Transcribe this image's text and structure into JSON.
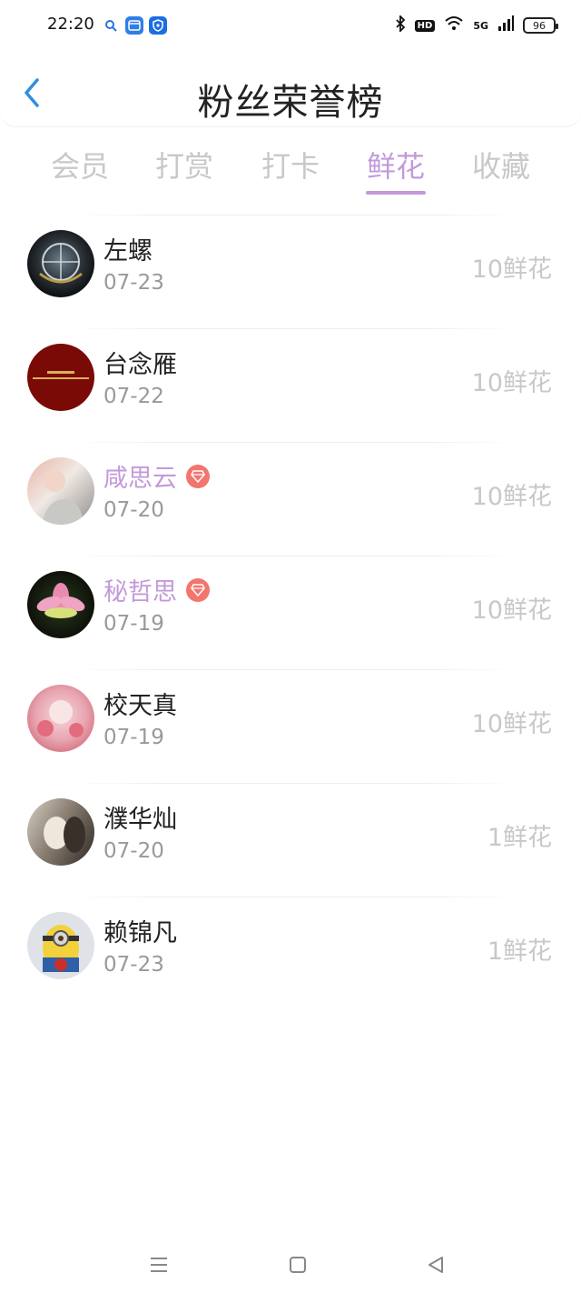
{
  "status_bar": {
    "time": "22:20",
    "network": "5G",
    "hd": "HD",
    "battery": "96"
  },
  "header": {
    "title": "粉丝荣誉榜"
  },
  "tabs": [
    {
      "label": "会员",
      "active": false
    },
    {
      "label": "打赏",
      "active": false
    },
    {
      "label": "打卡",
      "active": false
    },
    {
      "label": "鲜花",
      "active": true
    },
    {
      "label": "收藏",
      "active": false
    }
  ],
  "list": [
    {
      "name": "左螺",
      "date": "07-23",
      "amount": "10鲜花",
      "vip": false
    },
    {
      "name": "台念雁",
      "date": "07-22",
      "amount": "10鲜花",
      "vip": false
    },
    {
      "name": "咸思云",
      "date": "07-20",
      "amount": "10鲜花",
      "vip": true
    },
    {
      "name": "秘哲思",
      "date": "07-19",
      "amount": "10鲜花",
      "vip": true
    },
    {
      "name": "校天真",
      "date": "07-19",
      "amount": "10鲜花",
      "vip": false
    },
    {
      "name": "濮华灿",
      "date": "07-20",
      "amount": "1鲜花",
      "vip": false
    },
    {
      "name": "赖锦凡",
      "date": "07-23",
      "amount": "1鲜花",
      "vip": false
    }
  ],
  "colors": {
    "accent": "#c39ad9",
    "back_arrow": "#2d8fe0",
    "vip_badge": "#f2756e",
    "inactive": "#c8c8c8"
  }
}
